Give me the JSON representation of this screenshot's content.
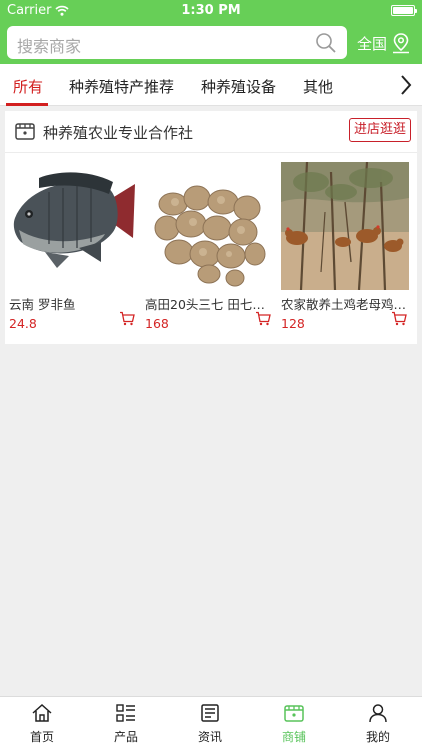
{
  "status": {
    "carrier": "Carrier",
    "time": "1:30 PM"
  },
  "search": {
    "placeholder": "搜索商家"
  },
  "region": {
    "label": "全国"
  },
  "tabs": [
    {
      "label": "所有",
      "active": true
    },
    {
      "label": "种养殖特产推荐",
      "active": false
    },
    {
      "label": "种养殖设备",
      "active": false
    },
    {
      "label": "其他",
      "active": false
    }
  ],
  "shop": {
    "name": "种养殖农业专业合作社",
    "enter_label": "进店逛逛",
    "products": [
      {
        "title": "云南 罗非鱼",
        "price": "24.8"
      },
      {
        "title": "高田20头三七 田七2…",
        "price": "168"
      },
      {
        "title": "农家散养土鸡老母鸡…",
        "price": "128"
      }
    ]
  },
  "bottom_nav": [
    {
      "label": "首页",
      "icon": "home-icon",
      "active": false
    },
    {
      "label": "产品",
      "icon": "grid-list-icon",
      "active": false
    },
    {
      "label": "资讯",
      "icon": "news-icon",
      "active": false
    },
    {
      "label": "商铺",
      "icon": "store-icon",
      "active": true
    },
    {
      "label": "我的",
      "icon": "user-icon",
      "active": false
    }
  ],
  "colors": {
    "brand_green": "#67cf57",
    "accent_red": "#d21f1f",
    "active_nav": "#58c35a"
  }
}
